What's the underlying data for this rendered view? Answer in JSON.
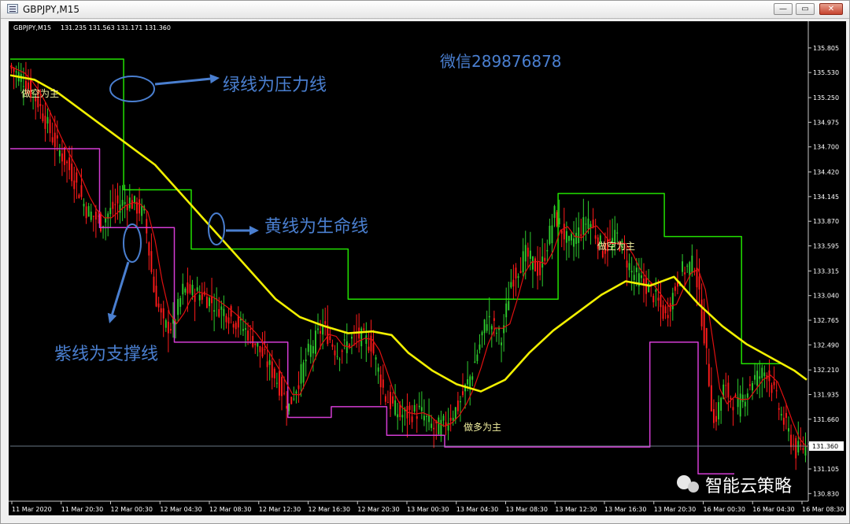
{
  "window": {
    "title": "GBPJPY,M15",
    "buttons": {
      "minimize": "—",
      "maximize": "▭",
      "close": "✕"
    }
  },
  "chart_data": {
    "type": "candlestick",
    "symbol_header": "GBPJPY,M15",
    "ohlc_header": "131.235 131.563 131.171 131.360",
    "price_axis_ticks": [
      "135.805",
      "135.530",
      "135.250",
      "134.975",
      "134.700",
      "134.420",
      "134.145",
      "133.870",
      "133.595",
      "133.315",
      "133.040",
      "132.765",
      "132.490",
      "132.210",
      "131.935",
      "131.660",
      "131.385",
      "131.105",
      "130.830"
    ],
    "price_axis_values": [
      135.805,
      135.53,
      135.25,
      134.975,
      134.7,
      134.42,
      134.145,
      133.87,
      133.595,
      133.315,
      133.04,
      132.765,
      132.49,
      132.21,
      131.935,
      131.66,
      131.385,
      131.105,
      130.83
    ],
    "current_price_label": "131.360",
    "current_price": 131.36,
    "ylim": [
      130.78,
      136.05
    ],
    "x_ticks": [
      "11 Mar 2020",
      "11 Mar 20:30",
      "12 Mar 00:30",
      "12 Mar 04:30",
      "12 Mar 08:30",
      "12 Mar 12:30",
      "12 Mar 16:30",
      "12 Mar 20:30",
      "13 Mar 00:30",
      "13 Mar 04:30",
      "13 Mar 08:30",
      "13 Mar 12:30",
      "13 Mar 16:30",
      "13 Mar 20:30",
      "16 Mar 00:30",
      "16 Mar 04:30",
      "16 Mar 08:30"
    ],
    "bar_count": 330,
    "price_path": [
      [
        0,
        135.6
      ],
      [
        6,
        135.45
      ],
      [
        12,
        135.2
      ],
      [
        18,
        134.8
      ],
      [
        26,
        134.4
      ],
      [
        32,
        134.0
      ],
      [
        38,
        133.85
      ],
      [
        44,
        134.05
      ],
      [
        50,
        134.1
      ],
      [
        56,
        133.95
      ],
      [
        60,
        133.1
      ],
      [
        64,
        132.7
      ],
      [
        68,
        132.7
      ],
      [
        72,
        133.1
      ],
      [
        80,
        133.05
      ],
      [
        90,
        132.85
      ],
      [
        100,
        132.6
      ],
      [
        110,
        132.15
      ],
      [
        116,
        131.8
      ],
      [
        124,
        132.4
      ],
      [
        130,
        132.7
      ],
      [
        136,
        132.4
      ],
      [
        144,
        132.6
      ],
      [
        150,
        132.5
      ],
      [
        156,
        131.9
      ],
      [
        162,
        131.7
      ],
      [
        170,
        131.75
      ],
      [
        176,
        131.55
      ],
      [
        180,
        131.6
      ],
      [
        186,
        131.8
      ],
      [
        192,
        132.2
      ],
      [
        198,
        132.8
      ],
      [
        204,
        132.55
      ],
      [
        208,
        133.2
      ],
      [
        214,
        133.5
      ],
      [
        220,
        133.3
      ],
      [
        226,
        133.95
      ],
      [
        232,
        133.6
      ],
      [
        240,
        133.9
      ],
      [
        246,
        133.55
      ],
      [
        252,
        133.7
      ],
      [
        258,
        133.3
      ],
      [
        266,
        133.1
      ],
      [
        272,
        132.8
      ],
      [
        278,
        133.3
      ],
      [
        284,
        133.4
      ],
      [
        288,
        132.6
      ],
      [
        292,
        131.6
      ],
      [
        296,
        132.0
      ],
      [
        302,
        131.8
      ],
      [
        308,
        132.1
      ],
      [
        314,
        132.2
      ],
      [
        320,
        131.7
      ],
      [
        326,
        131.3
      ],
      [
        330,
        131.36
      ]
    ],
    "green_resistance_line": [
      [
        0,
        135.68
      ],
      [
        47,
        135.68
      ],
      [
        47,
        134.22
      ],
      [
        75,
        134.22
      ],
      [
        75,
        133.56
      ],
      [
        140,
        133.56
      ],
      [
        140,
        133.0
      ],
      [
        227,
        133.0
      ],
      [
        227,
        134.18
      ],
      [
        271,
        134.18
      ],
      [
        271,
        133.7
      ],
      [
        303,
        133.7
      ],
      [
        303,
        132.28
      ],
      [
        320,
        132.28
      ]
    ],
    "magenta_support_line": [
      [
        0,
        134.68
      ],
      [
        37,
        134.68
      ],
      [
        37,
        133.8
      ],
      [
        68,
        133.8
      ],
      [
        68,
        132.52
      ],
      [
        115,
        132.52
      ],
      [
        115,
        131.68
      ],
      [
        133,
        131.68
      ],
      [
        133,
        131.8
      ],
      [
        156,
        131.8
      ],
      [
        156,
        131.48
      ],
      [
        180,
        131.48
      ],
      [
        180,
        131.35
      ],
      [
        265,
        131.35
      ],
      [
        265,
        132.52
      ],
      [
        285,
        132.52
      ],
      [
        285,
        131.05
      ],
      [
        300,
        131.05
      ]
    ],
    "yellow_ma_line": [
      [
        0,
        135.5
      ],
      [
        10,
        135.45
      ],
      [
        20,
        135.3
      ],
      [
        30,
        135.1
      ],
      [
        40,
        134.9
      ],
      [
        50,
        134.7
      ],
      [
        60,
        134.5
      ],
      [
        70,
        134.2
      ],
      [
        80,
        133.9
      ],
      [
        90,
        133.6
      ],
      [
        100,
        133.3
      ],
      [
        110,
        133.0
      ],
      [
        120,
        132.8
      ],
      [
        130,
        132.7
      ],
      [
        140,
        132.62
      ],
      [
        150,
        132.64
      ],
      [
        158,
        132.6
      ],
      [
        165,
        132.4
      ],
      [
        175,
        132.2
      ],
      [
        185,
        132.05
      ],
      [
        195,
        131.97
      ],
      [
        205,
        132.1
      ],
      [
        215,
        132.4
      ],
      [
        225,
        132.65
      ],
      [
        235,
        132.85
      ],
      [
        245,
        133.05
      ],
      [
        255,
        133.2
      ],
      [
        265,
        133.15
      ],
      [
        275,
        133.25
      ],
      [
        285,
        132.95
      ],
      [
        295,
        132.7
      ],
      [
        305,
        132.5
      ],
      [
        315,
        132.35
      ],
      [
        325,
        132.2
      ],
      [
        330,
        132.1
      ]
    ],
    "annotations": {
      "wechat": "微信289876878",
      "green_note": "绿线为压力线",
      "yellow_note": "黄线为生命线",
      "purple_note": "紫线为支撑线",
      "short_1": "做空为主",
      "short_2": "做空为主",
      "long_1": "做多为主",
      "watermark": "智能云策略"
    },
    "colors": {
      "background": "#000000",
      "green_line": "#22e000",
      "magenta_line": "#d43cd4",
      "yellow_line": "#f2f000",
      "red_line": "#e01010",
      "bull_candle": "#2ecc2e",
      "bear_candle": "#ff1a1a",
      "annotation_blue": "#4a7fd0"
    }
  }
}
